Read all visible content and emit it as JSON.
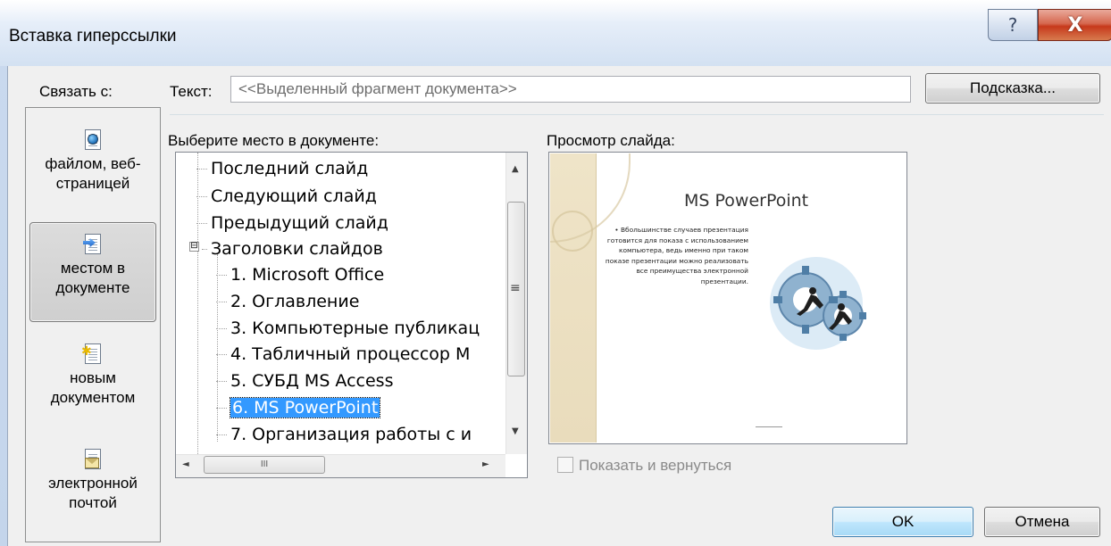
{
  "window": {
    "title": "Вставка гиперссылки",
    "help_glyph": "?",
    "close_glyph": "X"
  },
  "link_with": {
    "label": "Связать с:",
    "items": [
      {
        "label_line1": "файлом, веб-",
        "label_line2": "страницей",
        "icon": "file-web-icon",
        "selected": false
      },
      {
        "label_line1": "местом в",
        "label_line2": "документе",
        "icon": "place-in-document-icon",
        "selected": true
      },
      {
        "label_line1": "новым",
        "label_line2": "документом",
        "icon": "new-document-icon",
        "selected": false
      },
      {
        "label_line1": "электронной",
        "label_line2": "почтой",
        "icon": "email-icon",
        "selected": false
      }
    ]
  },
  "text_field": {
    "label": "Текст:",
    "value": "<<Выделенный фрагмент документа>>"
  },
  "buttons": {
    "hint": "Подсказка...",
    "ok": "OK",
    "cancel": "Отмена"
  },
  "place": {
    "label": "Выберите место в документе:",
    "tree": [
      {
        "text": "Последний слайд",
        "level": 1
      },
      {
        "text": "Следующий слайд",
        "level": 1
      },
      {
        "text": "Предыдущий слайд",
        "level": 1
      },
      {
        "text": "Заголовки слайдов",
        "level": 1,
        "expander": "⊟"
      },
      {
        "text": "1. Microsoft Office",
        "level": 2
      },
      {
        "text": "2. Оглавление",
        "level": 2
      },
      {
        "text": "3. Компьютерные публикац",
        "level": 2
      },
      {
        "text": "4. Табличный процессор М",
        "level": 2
      },
      {
        "text": "5. СУБД MS Access",
        "level": 2
      },
      {
        "text": "6. MS PowerPoint",
        "level": 2,
        "selected": true
      },
      {
        "text": "7. Организация работы с и",
        "level": 2
      }
    ],
    "scroll_glyphs": {
      "up": "▲",
      "down": "▼",
      "left": "◄",
      "right": "►",
      "grip_v": "≡",
      "grip_h": "III"
    }
  },
  "preview": {
    "label": "Просмотр слайда:",
    "slide_title": "MS PowerPoint",
    "slide_body": "• Вбольшинстве случаев презентация готовится для показа с использованием компьютера, ведь именно при таком показе презентации можно реализовать все преимущества электронной презентации."
  },
  "show_and_return": {
    "label": "Показать и вернуться",
    "checked": false,
    "enabled": false
  },
  "colors": {
    "selection": "#3399ff",
    "close_button": "#c7391c",
    "ok_border": "#3c7fb1"
  }
}
